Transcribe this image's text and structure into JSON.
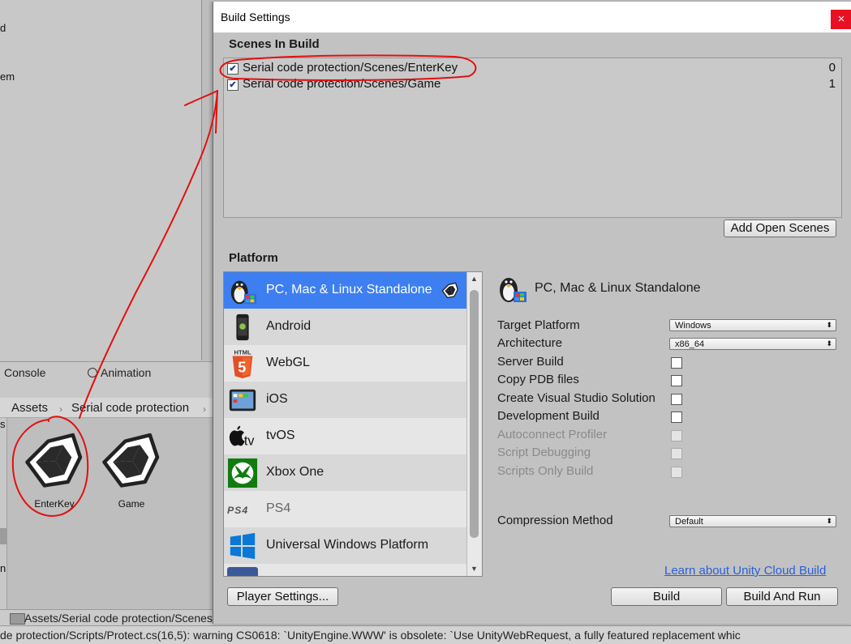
{
  "hierarchy": {
    "items": [
      "d",
      "em"
    ]
  },
  "tabs": {
    "console": "Console",
    "animation": "Animation"
  },
  "breadcrumb": {
    "root": "Assets",
    "folder": "Serial code protection"
  },
  "assets": {
    "items": [
      "EnterKey",
      "Game"
    ],
    "left_fragment": "s",
    "left_fragment2": "n"
  },
  "path_bar": {
    "text": "Assets/Serial code protection/Scenes"
  },
  "status_bar": {
    "text": "de protection/Scripts/Protect.cs(16,5): warning CS0618: `UnityEngine.WWW' is obsolete: `Use UnityWebRequest, a fully featured replacement whic"
  },
  "window": {
    "title": "Build Settings",
    "close_glyph": "×",
    "scenes_header": "Scenes In Build",
    "scenes": [
      {
        "name": "Serial code protection/Scenes/EnterKey",
        "index": "0",
        "checked": true
      },
      {
        "name": "Serial code protection/Scenes/Game",
        "index": "1",
        "checked": true
      }
    ],
    "add_open_scenes": "Add Open Scenes",
    "platform_header": "Platform",
    "platforms": [
      {
        "label": "PC, Mac & Linux Standalone",
        "icon": "penguin-icon",
        "selected": true
      },
      {
        "label": "Android",
        "icon": "android-phone-icon"
      },
      {
        "label": "WebGL",
        "icon": "html5-icon"
      },
      {
        "label": "iOS",
        "icon": "ipad-icon"
      },
      {
        "label": "tvOS",
        "icon": "apple-tv-icon"
      },
      {
        "label": "Xbox One",
        "icon": "xbox-icon"
      },
      {
        "label": "PS4",
        "icon": "ps4-logo"
      },
      {
        "label": "Universal Windows Platform",
        "icon": "windows-icon"
      }
    ],
    "html_badge": "HTML",
    "html_five": "5",
    "tv_text": "tv",
    "ps4_text": "PS4",
    "selected_platform": "PC, Mac & Linux Standalone",
    "options": {
      "target_platform_label": "Target Platform",
      "target_platform_value": "Windows",
      "architecture_label": "Architecture",
      "architecture_value": "x86_64",
      "checkboxes": [
        {
          "label": "Server Build",
          "enabled": true
        },
        {
          "label": "Copy PDB files",
          "enabled": true
        },
        {
          "label": "Create Visual Studio Solution",
          "enabled": true
        },
        {
          "label": "Development Build",
          "enabled": true
        },
        {
          "label": "Autoconnect Profiler",
          "enabled": false
        },
        {
          "label": "Script Debugging",
          "enabled": false
        },
        {
          "label": "Scripts Only Build",
          "enabled": false
        }
      ],
      "compression_label": "Compression Method",
      "compression_value": "Default"
    },
    "learn_link": "Learn about Unity Cloud Build",
    "player_settings": "Player Settings...",
    "build": "Build",
    "build_and_run": "Build And Run"
  },
  "colors": {
    "selection": "#3d7ff0",
    "close": "#e81123",
    "annotation": "#e31010",
    "link": "#2a5fd8"
  }
}
